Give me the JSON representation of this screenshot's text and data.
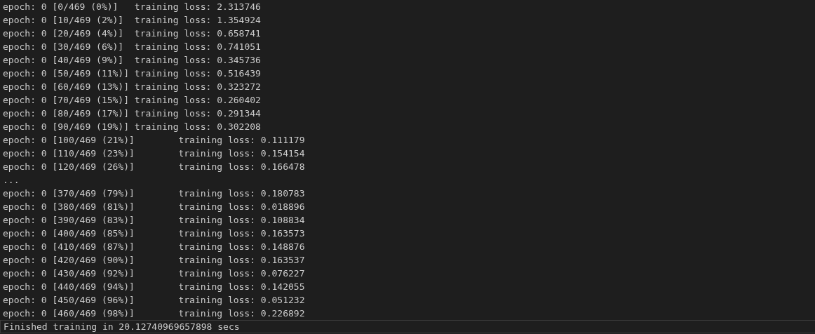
{
  "terminal": {
    "lines": [
      {
        "kind": "output",
        "text": "epoch: 0 [0/469 (0%)]\ttraining loss: 2.313746"
      },
      {
        "kind": "output",
        "text": "epoch: 0 [10/469 (2%)]\ttraining loss: 1.354924"
      },
      {
        "kind": "output",
        "text": "epoch: 0 [20/469 (4%)]\ttraining loss: 0.658741"
      },
      {
        "kind": "output",
        "text": "epoch: 0 [30/469 (6%)]\ttraining loss: 0.741051"
      },
      {
        "kind": "output",
        "text": "epoch: 0 [40/469 (9%)]\ttraining loss: 0.345736"
      },
      {
        "kind": "output",
        "text": "epoch: 0 [50/469 (11%)]\ttraining loss: 0.516439"
      },
      {
        "kind": "output",
        "text": "epoch: 0 [60/469 (13%)]\ttraining loss: 0.323272"
      },
      {
        "kind": "output",
        "text": "epoch: 0 [70/469 (15%)]\ttraining loss: 0.260402"
      },
      {
        "kind": "output",
        "text": "epoch: 0 [80/469 (17%)]\ttraining loss: 0.291344"
      },
      {
        "kind": "output",
        "text": "epoch: 0 [90/469 (19%)]\ttraining loss: 0.302208"
      },
      {
        "kind": "output",
        "text": "epoch: 0 [100/469 (21%)]\ttraining loss: 0.111179"
      },
      {
        "kind": "output",
        "text": "epoch: 0 [110/469 (23%)]\ttraining loss: 0.154154"
      },
      {
        "kind": "output",
        "text": "epoch: 0 [120/469 (26%)]\ttraining loss: 0.166478"
      },
      {
        "kind": "output",
        "text": "..."
      },
      {
        "kind": "output",
        "text": "epoch: 0 [370/469 (79%)]\ttraining loss: 0.180783"
      },
      {
        "kind": "output",
        "text": "epoch: 0 [380/469 (81%)]\ttraining loss: 0.018896"
      },
      {
        "kind": "output",
        "text": "epoch: 0 [390/469 (83%)]\ttraining loss: 0.108834"
      },
      {
        "kind": "output",
        "text": "epoch: 0 [400/469 (85%)]\ttraining loss: 0.163573"
      },
      {
        "kind": "output",
        "text": "epoch: 0 [410/469 (87%)]\ttraining loss: 0.148876"
      },
      {
        "kind": "output",
        "text": "epoch: 0 [420/469 (90%)]\ttraining loss: 0.163537"
      },
      {
        "kind": "output",
        "text": "epoch: 0 [430/469 (92%)]\ttraining loss: 0.076227"
      },
      {
        "kind": "output",
        "text": "epoch: 0 [440/469 (94%)]\ttraining loss: 0.142055"
      },
      {
        "kind": "output",
        "text": "epoch: 0 [450/469 (96%)]\ttraining loss: 0.051232"
      },
      {
        "kind": "output",
        "text": "epoch: 0 [460/469 (98%)]\ttraining loss: 0.226892"
      },
      {
        "kind": "current",
        "text": "Finished training in 20.12740969657898 secs"
      }
    ]
  }
}
